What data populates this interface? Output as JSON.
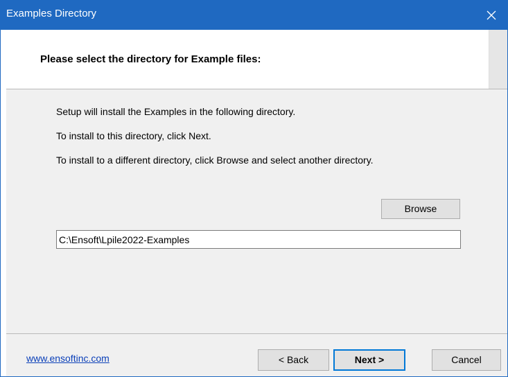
{
  "window": {
    "title": "Examples Directory",
    "accent_color": "#1f69c1",
    "close_icon": "close-icon"
  },
  "header": {
    "title": "Please select the directory for Example files:"
  },
  "body": {
    "lines": [
      "Setup will install the Examples in the following directory.",
      "To install to this directory, click Next.",
      "To install to a different directory, click Browse and select another directory."
    ],
    "browse_label": "Browse",
    "path_value": "C:\\Ensoft\\Lpile2022-Examples"
  },
  "footer": {
    "link_text": "www.ensoftinc.com",
    "back_label": "< Back",
    "next_label": "Next >",
    "cancel_label": "Cancel"
  }
}
